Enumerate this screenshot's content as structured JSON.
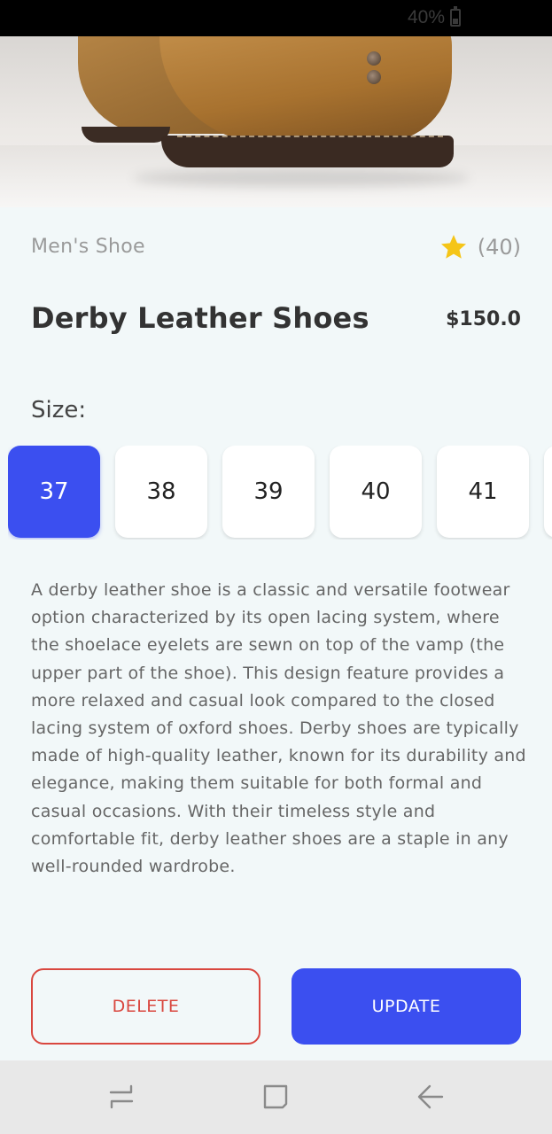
{
  "status_bar": {
    "battery_text": "40%"
  },
  "product": {
    "category": "Men's Shoe",
    "rating_count": "(40)",
    "title": "Derby Leather Shoes",
    "price": "$150.0",
    "size_label": "Size:",
    "sizes": [
      "37",
      "38",
      "39",
      "40",
      "41"
    ],
    "selected_size": "37",
    "description": "A derby leather shoe is a classic and versatile footwear option characterized by its open lacing system, where the shoelace eyelets are sewn on top of the vamp (the upper part of the shoe). This design feature provides a more relaxed and casual look compared to the closed lacing system of oxford shoes. Derby shoes are typically made of high-quality leather, known for its durability and elegance, making them suitable for both formal and casual occasions. With their timeless style and comfortable fit, derby leather shoes are a staple in any well-rounded wardrobe."
  },
  "actions": {
    "delete_label": "DELETE",
    "update_label": "UPDATE"
  },
  "icons": {
    "star": "star-icon",
    "battery": "battery-icon",
    "nav_recent": "recent-apps-icon",
    "nav_home": "home-icon",
    "nav_back": "back-arrow-icon"
  },
  "colors": {
    "accent": "#3b4ff0",
    "delete": "#d9473f",
    "star": "#f5c518",
    "background": "#f2f8f9"
  }
}
